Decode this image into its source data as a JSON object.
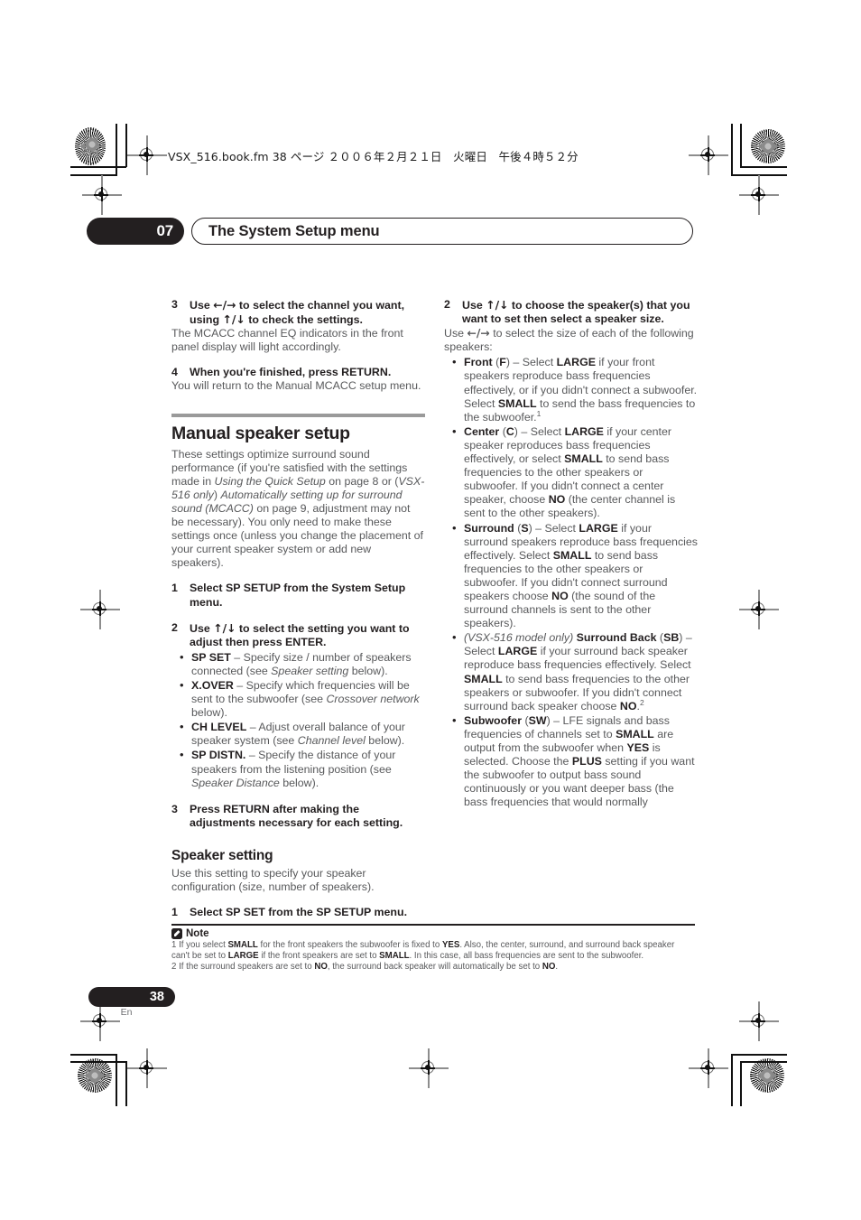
{
  "print_marks": {
    "filename_line": "VSX_516.book.fm 38 ページ ２００６年２月２１日　火曜日　午後４時５２分"
  },
  "header": {
    "chapter_number": "07",
    "chapter_title": "The System Setup menu"
  },
  "left_column": {
    "step3_num": "3",
    "step3_text_a": "Use ",
    "step3_arrow1": "←/→",
    "step3_text_b": " to select the channel you want, using ",
    "step3_arrow2": "↑/↓",
    "step3_text_c": " to check the settings.",
    "step3_body": "The MCACC channel EQ indicators in the front panel display will light accordingly.",
    "step4_num": "4",
    "step4_text": "When you're finished, press RETURN.",
    "step4_body": "You will return to the Manual MCACC setup menu.",
    "section_heading": "Manual speaker setup",
    "intro_1": "These settings optimize surround sound performance (if you're satisfied with the settings made in ",
    "intro_italic_1": "Using the Quick Setup",
    "intro_2": " on page 8 or (",
    "intro_italic_2": "VSX-516 only",
    "intro_3": ") ",
    "intro_italic_3": "Automatically setting up for surround sound (MCACC)",
    "intro_4": " on page 9, adjustment may not be necessary). You only need to make these settings once (unless you change the placement of your current speaker system or add new speakers).",
    "step1_num": "1",
    "step1_text": "Select SP SETUP from the System Setup menu.",
    "step2_num": "2",
    "step2_text_a": "Use ",
    "step2_arrow": "↑/↓",
    "step2_text_b": " to select the setting you want to adjust then press ENTER.",
    "bullets": [
      {
        "term": "SP SET",
        "dash": " – ",
        "text_a": "Specify size / number of speakers connected (see ",
        "italic": "Speaker setting",
        "text_b": " below)."
      },
      {
        "term": "X.OVER",
        "dash": " – ",
        "text_a": "Specify which frequencies will be sent to the subwoofer (see ",
        "italic": "Crossover network",
        "text_b": " below)."
      },
      {
        "term": "CH LEVEL",
        "dash": " – ",
        "text_a": "Adjust overall balance of your speaker system (see ",
        "italic": "Channel level",
        "text_b": " below)."
      },
      {
        "term": "SP DISTN.",
        "dash": " – ",
        "text_a": "Specify the distance of your speakers from the listening position (see ",
        "italic": "Speaker Distance",
        "text_b": " below)."
      }
    ],
    "step3b_num": "3",
    "step3b_text": "Press RETURN after making the adjustments necessary for each setting.",
    "sub_heading": "Speaker setting",
    "sub_body": "Use this setting to specify your speaker configuration (size, number of speakers).",
    "step1b_num": "1",
    "step1b_text": "Select SP SET from the SP SETUP menu."
  },
  "right_column": {
    "step2_num": "2",
    "step2_text_a": "Use ",
    "step2_arrow": "↑/↓",
    "step2_text_b": " to choose the speaker(s) that you want to set then select a speaker size.",
    "step2_body_a": "Use ",
    "step2_body_arrow": "←/→",
    "step2_body_b": " to select the size of each of the following speakers:",
    "speakers": [
      {
        "name": "Front",
        "abbrev_open": " (",
        "abbrev": "F",
        "abbrev_close": ") – ",
        "t1": "Select ",
        "v1": "LARGE",
        "t2": " if your front speakers reproduce bass frequencies effectively, or if you didn't connect a subwoofer. Select ",
        "v2": "SMALL",
        "t3": " to send the bass frequencies to the subwoofer.",
        "footnote_ref": "1"
      },
      {
        "name": "Center",
        "abbrev_open": " (",
        "abbrev": "C",
        "abbrev_close": ") – ",
        "t1": "Select ",
        "v1": "LARGE",
        "t2": " if your center speaker reproduces bass frequencies effectively, or select ",
        "v2": "SMALL",
        "t3": " to send bass frequencies to the other speakers or subwoofer. If you didn't connect a center speaker, choose ",
        "v3": "NO",
        "t4": " (the center channel is sent to the other speakers)."
      },
      {
        "name": "Surround",
        "abbrev_open": " (",
        "abbrev": "S",
        "abbrev_close": ") – ",
        "t1": "Select ",
        "v1": "LARGE",
        "t2": " if your surround speakers reproduce bass frequencies effectively. Select ",
        "v2": "SMALL",
        "t3": " to send bass frequencies to the other speakers or subwoofer. If you didn't connect surround speakers choose ",
        "v3": "NO",
        "t4": " (the sound of the surround channels is sent to the other speakers)."
      },
      {
        "prefix_italic": "(VSX-516 model only)",
        "name": " Surround Back",
        "abbrev_open": " (",
        "abbrev": "SB",
        "abbrev_close": ") – ",
        "t1": "Select ",
        "v1": "LARGE",
        "t2": " if your surround back speaker reproduce bass frequencies effectively. Select ",
        "v2": "SMALL",
        "t3": " to send bass frequencies to the other speakers or subwoofer. If you didn't connect surround back speaker choose ",
        "v3": "NO",
        "t4": ".",
        "footnote_ref": "2"
      },
      {
        "name": "Subwoofer",
        "abbrev_open": " (",
        "abbrev": "SW",
        "abbrev_close": ") – ",
        "t1": "LFE signals and bass frequencies of channels set to ",
        "v1": "SMALL",
        "t2": " are output from the subwoofer when ",
        "v2": "YES",
        "t3": " is selected. Choose the ",
        "v3": "PLUS",
        "t4": " setting if you want the subwoofer to output bass sound continuously or you want deeper bass (the bass frequencies that would normally"
      }
    ]
  },
  "note": {
    "label": "Note",
    "footnote1_a": "1 If you select ",
    "footnote1_b1": "SMALL",
    "footnote1_c": " for the front speakers the subwoofer is fixed to ",
    "footnote1_b2": "YES",
    "footnote1_d": ". Also, the center, surround, and surround back speaker can't be set to ",
    "footnote1_b3": "LARGE",
    "footnote1_e": " if the front speakers are set to ",
    "footnote1_b4": "SMALL",
    "footnote1_f": ". In this case, all bass frequencies are sent to the subwoofer.",
    "footnote2_a": "2 If the surround speakers are set to ",
    "footnote2_b1": "NO",
    "footnote2_c": ", the surround back speaker will automatically be set to ",
    "footnote2_b2": "NO",
    "footnote2_d": "."
  },
  "footer": {
    "page_number": "38",
    "language": "En"
  }
}
